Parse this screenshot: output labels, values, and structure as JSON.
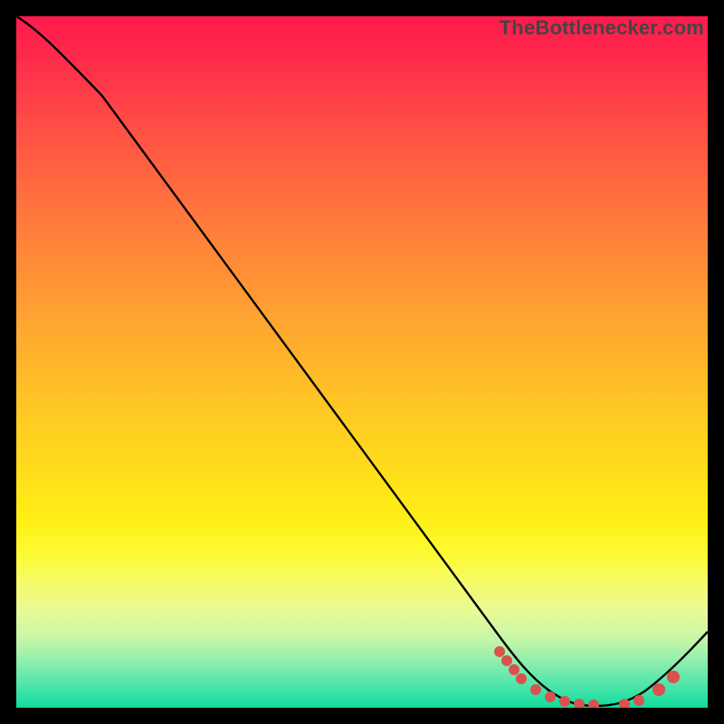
{
  "watermark": "TheBottlenecker.com",
  "chart_data": {
    "type": "line",
    "title": "",
    "xlabel": "",
    "ylabel": "",
    "xlim": [
      0,
      100
    ],
    "ylim": [
      0,
      100
    ],
    "series": [
      {
        "name": "curve",
        "x": [
          0,
          3,
          6,
          10,
          15,
          20,
          25,
          30,
          35,
          40,
          45,
          50,
          55,
          60,
          65,
          70,
          73,
          76,
          79,
          82,
          85,
          88,
          91,
          94,
          97,
          100
        ],
        "y": [
          100,
          99,
          97,
          94,
          88,
          81,
          74,
          67,
          60,
          53,
          46,
          39,
          32,
          25,
          18,
          11,
          7,
          4,
          2,
          0.7,
          0.3,
          0.5,
          1.2,
          3,
          6,
          10
        ]
      }
    ],
    "markers": [
      {
        "name": "dots",
        "color": "#d9524e",
        "x": [
          70,
          71,
          72,
          73,
          75,
          77,
          79,
          81,
          83,
          88,
          90,
          93,
          95
        ],
        "y": [
          7,
          6,
          5,
          4,
          3,
          2.3,
          1.6,
          1.1,
          0.8,
          0.6,
          0.8,
          2,
          3.5
        ]
      }
    ],
    "colors": {
      "curve": "#000000",
      "marker": "#d9524e",
      "gradient_top": "#ff1a4d",
      "gradient_bottom": "#17d69a"
    }
  }
}
